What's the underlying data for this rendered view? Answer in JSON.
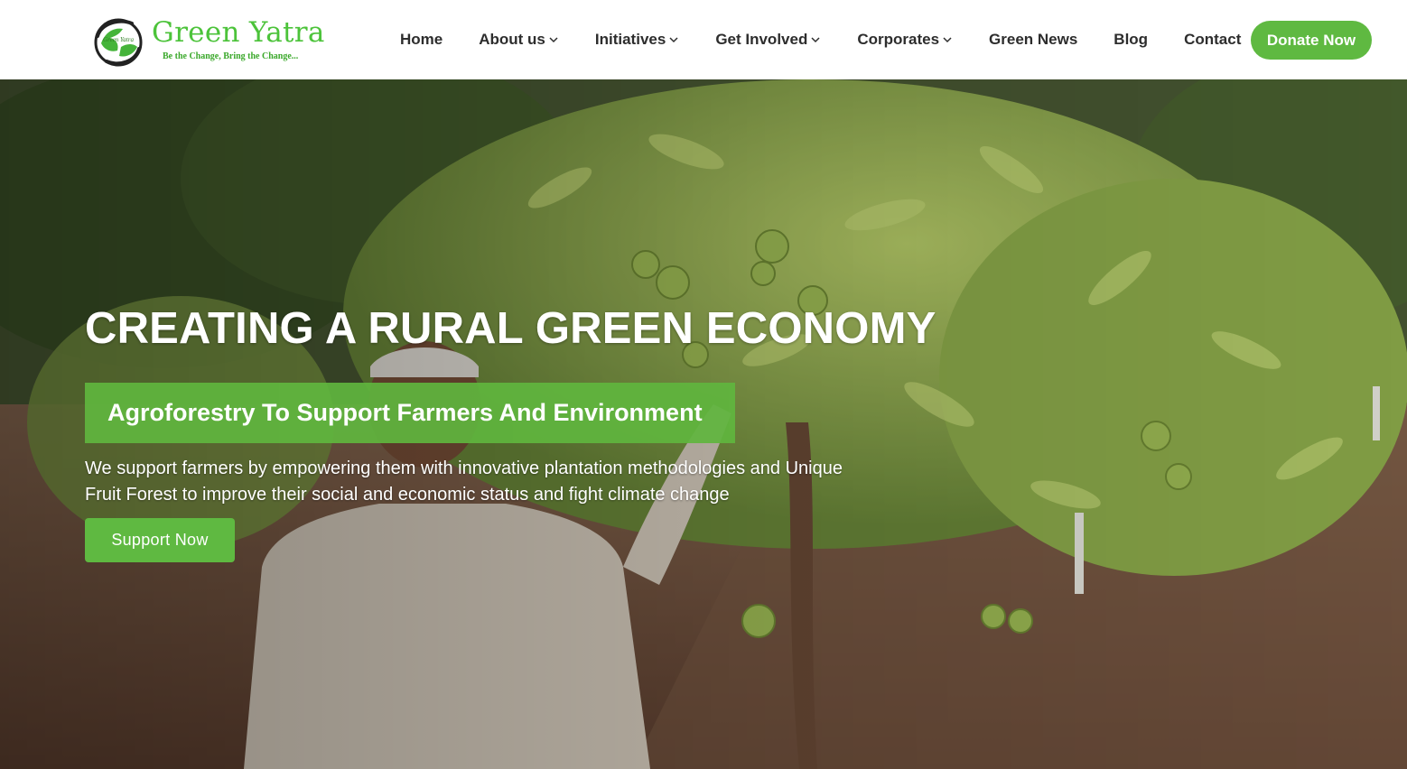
{
  "brand": {
    "name": "Green Yatra",
    "tagline": "Be the Change, Bring the Change...",
    "mark_text": "Green Yatra",
    "logo_icon": "globe-leaf-icon"
  },
  "nav": {
    "items": [
      {
        "label": "Home",
        "dropdown": false
      },
      {
        "label": "About us",
        "dropdown": true
      },
      {
        "label": "Initiatives",
        "dropdown": true
      },
      {
        "label": "Get Involved",
        "dropdown": true
      },
      {
        "label": "Corporates",
        "dropdown": true
      },
      {
        "label": "Green News",
        "dropdown": false
      },
      {
        "label": "Blog",
        "dropdown": false
      },
      {
        "label": "Contact",
        "dropdown": false
      }
    ],
    "donate_label": "Donate Now"
  },
  "hero": {
    "title": "CREATING A RURAL GREEN ECONOMY",
    "banner": "Agroforestry To Support Farmers And Environment",
    "description": "We support farmers by empowering them with innovative plantation methodologies and Unique Fruit Forest to improve their social and economic status and fight climate change",
    "button_label": "Support Now",
    "background": "farmer-with-guava-tree-photo"
  },
  "colors": {
    "brand_green": "#5fb941",
    "logo_green": "#4cc33a",
    "nav_text": "#2d2d2d",
    "white": "#ffffff"
  }
}
